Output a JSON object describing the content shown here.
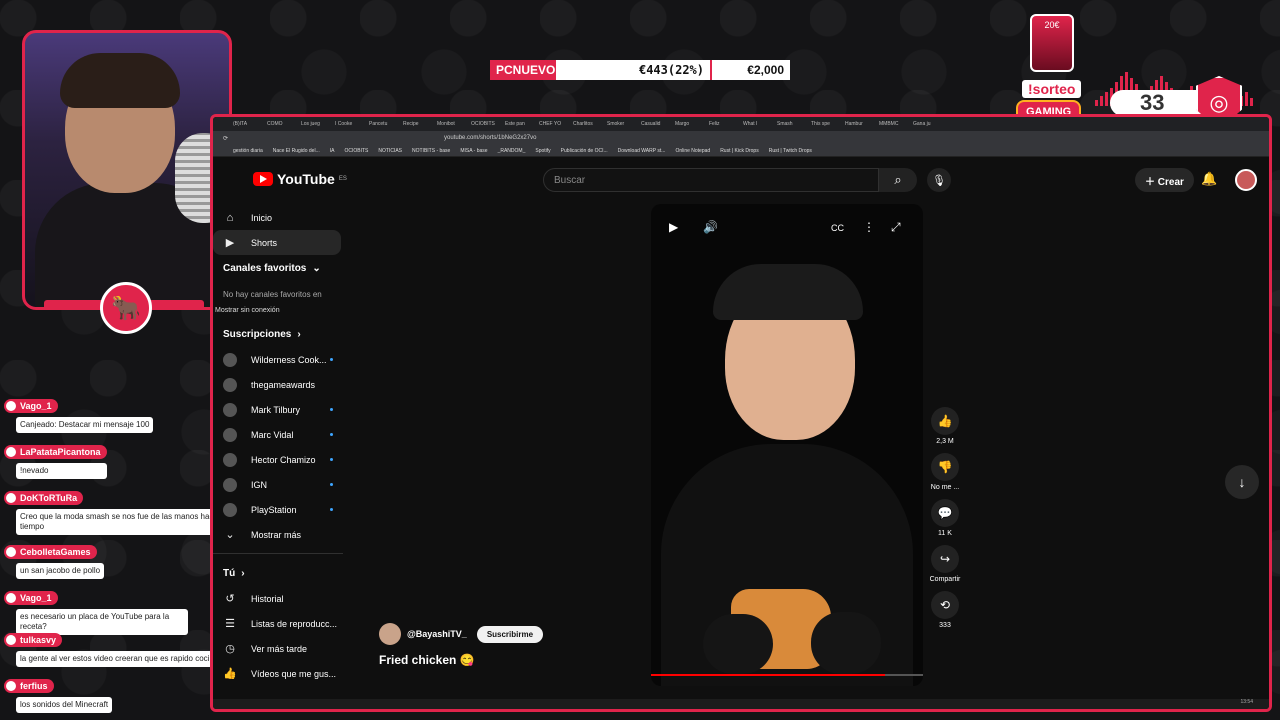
{
  "overlay": {
    "ticker": {
      "label": "PCNUEVO",
      "amount": "€443(22%)",
      "goal": "€2,000"
    },
    "sorteo": "!sorteo",
    "gaming": "GAMING",
    "card_price": "20€",
    "counter": "33",
    "accent": "#e0244b"
  },
  "chat": {
    "messages": [
      {
        "user": "Vago_1",
        "text": "Canjeado: Destacar mi mensaje 100"
      },
      {
        "user": "LaPatataPicantona",
        "text": "!nevado"
      },
      {
        "user": "DoKToRTuRa",
        "text": "Creo que la moda smash se nos fue de las manos hace tiempo"
      },
      {
        "user": "CebolletaGames",
        "text": "un san jacobo de pollo"
      },
      {
        "user": "Vago_1",
        "text": "es necesario un placa de YouTube para la receta?"
      },
      {
        "user": "tulkasvy",
        "text": "la gente al ver estos video creeran que es rapido cocinar"
      },
      {
        "user": "ferfius",
        "text": "los sonidos del Minecraft"
      }
    ]
  },
  "browser": {
    "url": "youtube.com/shorts/1bNeG2x27vo",
    "tabs": [
      "(B)ITA",
      "CÓMO",
      "Los jueg",
      "I Cooke",
      "Pancetu",
      "Recipe",
      "Monibot",
      "OCIOBITS",
      "Este pan",
      "CHEF YO",
      "Charlitos",
      "Smoker",
      "Casualid",
      "Margo",
      "Feliz",
      "What I",
      "Smash",
      "This spe",
      "Hambur",
      "MMBMC",
      "Gana ju"
    ],
    "bookmarks": [
      "gestión diaria",
      "Nace El Rugido del...",
      "IA",
      "OCIOBITS",
      "NOTICIAS",
      "NOTIBITS - base",
      "MISA - base",
      "_RANDOM_",
      "Spotify",
      "Publicación de OCI...",
      "Download WARP st...",
      "Online Notepad",
      "Rust | Kick Drops",
      "Rust | Twitch Drops"
    ],
    "taskbar_time": "13:54"
  },
  "youtube": {
    "logo": "YouTube",
    "region": "ES",
    "search_placeholder": "Buscar",
    "create_label": "Crear",
    "nav": [
      {
        "label": "Inicio",
        "icon": "home-icon"
      },
      {
        "label": "Shorts",
        "icon": "shorts-icon",
        "active": true
      }
    ],
    "favorites_heading": "Canales favoritos",
    "favorites_note": "No hay canales favoritos en",
    "offline_label": "Mostrar sin conexión",
    "subs_heading": "Suscripciones",
    "subscriptions": [
      {
        "name": "Wilderness Cook...",
        "dot": true
      },
      {
        "name": "thegameawards",
        "dot": false
      },
      {
        "name": "Mark Tilbury",
        "dot": true
      },
      {
        "name": "Marc Vidal",
        "dot": true
      },
      {
        "name": "Hector Chamizo",
        "dot": true
      },
      {
        "name": "IGN",
        "dot": true
      },
      {
        "name": "PlayStation",
        "dot": true
      }
    ],
    "show_more": "Mostrar más",
    "you_heading": "Tú",
    "you_items": [
      {
        "label": "Historial",
        "icon": "history-icon"
      },
      {
        "label": "Listas de reproducc...",
        "icon": "playlist-icon"
      },
      {
        "label": "Ver más tarde",
        "icon": "clock-icon"
      },
      {
        "label": "Vídeos que me gus...",
        "icon": "thumb-up-icon"
      }
    ],
    "short": {
      "channel": "@BayashiTV_",
      "subscribe": "Suscribirme",
      "title": "Fried chicken 😋",
      "progress": 0.86,
      "likes": "2,3 M",
      "dislike": "No me ...",
      "comments": "11 K",
      "share": "Compartir",
      "remix": "333"
    }
  }
}
